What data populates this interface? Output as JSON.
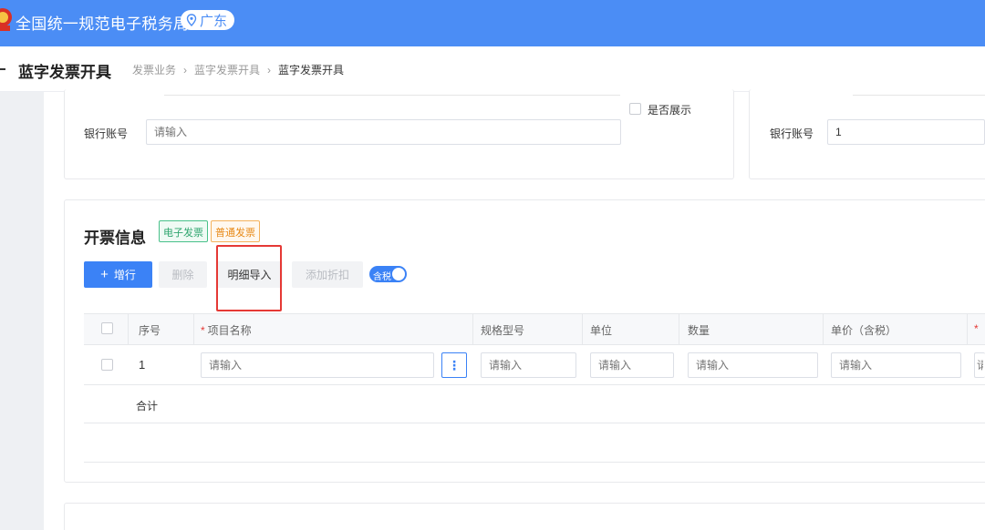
{
  "header": {
    "title": "全国统一规范电子税务局",
    "region": "广东",
    "logo_icon": "tax-emblem-icon",
    "location_icon": "location-pin-icon"
  },
  "subheader": {
    "page_title": "蓝字发票开具",
    "breadcrumb": [
      "发票业务",
      "蓝字发票开具",
      "蓝字发票开具"
    ]
  },
  "buyer_card": {
    "bank_account_label": "银行账号",
    "bank_account_placeholder": "请输入",
    "display_checkbox_label": "是否展示"
  },
  "seller_card": {
    "bank_account_label": "银行账号",
    "bank_account_value": "1"
  },
  "invoice_section": {
    "title": "开票信息",
    "tags": [
      "电子发票",
      "普通发票"
    ],
    "buttons": {
      "add_row": "增行",
      "delete": "删除",
      "import_detail": "明细导入",
      "add_discount": "添加折扣"
    },
    "tax_switch_label": "含税",
    "tax_switch_on": true,
    "table": {
      "columns": [
        "序号",
        "项目名称",
        "规格型号",
        "单位",
        "数量",
        "单价（含税）"
      ],
      "rows": [
        {
          "index": "1",
          "placeholders": [
            "请输入",
            "请输入",
            "请输入",
            "请输入",
            "请输入",
            "请"
          ]
        }
      ],
      "total_label": "合计"
    }
  },
  "colors": {
    "header_blue": "#4b8df5",
    "primary": "#3b82f6",
    "highlight_red": "#e53935",
    "tag_green": "#2fa56e",
    "tag_orange": "#e88a18"
  }
}
